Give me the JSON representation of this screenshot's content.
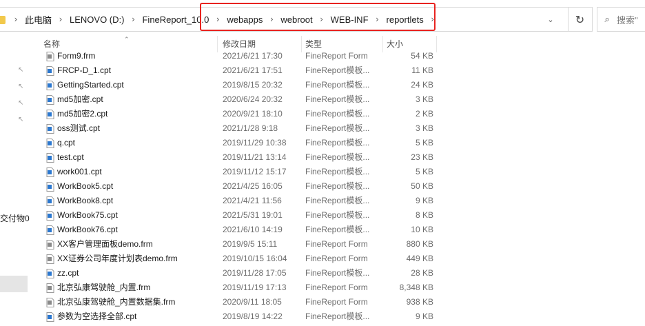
{
  "address": {
    "breadcrumbs": [
      "此电脑",
      "LENOVO (D:)",
      "FineReport_10.0",
      "webapps",
      "webroot",
      "WEB-INF",
      "reportlets"
    ],
    "dropdown_icon": "chevron-down-icon",
    "refresh_icon": "refresh-icon"
  },
  "search": {
    "placeholder": "搜索\""
  },
  "nav": {
    "partial_label": "交付物0"
  },
  "columns": {
    "name": "名称",
    "date": "修改日期",
    "type": "类型",
    "size": "大小"
  },
  "colors": {
    "highlight": "#e8231f",
    "cpt_icon": "#2b78d0",
    "frm_icon": "#8a8a8a"
  },
  "files": [
    {
      "name": "Form9.frm",
      "date": "2021/6/21 17:30",
      "type": "FineReport Form",
      "size": "54 KB",
      "kind": "frm"
    },
    {
      "name": "FRCP-D_1.cpt",
      "date": "2021/6/21 17:51",
      "type": "FineReport模板...",
      "size": "11 KB",
      "kind": "cpt"
    },
    {
      "name": "GettingStarted.cpt",
      "date": "2019/8/15 20:32",
      "type": "FineReport模板...",
      "size": "24 KB",
      "kind": "cpt"
    },
    {
      "name": "md5加密.cpt",
      "date": "2020/6/24 20:32",
      "type": "FineReport模板...",
      "size": "3 KB",
      "kind": "cpt"
    },
    {
      "name": "md5加密2.cpt",
      "date": "2020/9/21 18:10",
      "type": "FineReport模板...",
      "size": "2 KB",
      "kind": "cpt"
    },
    {
      "name": "oss测试.cpt",
      "date": "2021/1/28 9:18",
      "type": "FineReport模板...",
      "size": "3 KB",
      "kind": "cpt"
    },
    {
      "name": "q.cpt",
      "date": "2019/11/29 10:38",
      "type": "FineReport模板...",
      "size": "5 KB",
      "kind": "cpt"
    },
    {
      "name": "test.cpt",
      "date": "2019/11/21 13:14",
      "type": "FineReport模板...",
      "size": "23 KB",
      "kind": "cpt"
    },
    {
      "name": "work001.cpt",
      "date": "2019/11/12 15:17",
      "type": "FineReport模板...",
      "size": "5 KB",
      "kind": "cpt"
    },
    {
      "name": "WorkBook5.cpt",
      "date": "2021/4/25 16:05",
      "type": "FineReport模板...",
      "size": "50 KB",
      "kind": "cpt"
    },
    {
      "name": "WorkBook8.cpt",
      "date": "2021/4/21 11:56",
      "type": "FineReport模板...",
      "size": "9 KB",
      "kind": "cpt"
    },
    {
      "name": "WorkBook75.cpt",
      "date": "2021/5/31 19:01",
      "type": "FineReport模板...",
      "size": "8 KB",
      "kind": "cpt"
    },
    {
      "name": "WorkBook76.cpt",
      "date": "2021/6/10 14:19",
      "type": "FineReport模板...",
      "size": "10 KB",
      "kind": "cpt"
    },
    {
      "name": "XX客户管理面板demo.frm",
      "date": "2019/9/5 15:11",
      "type": "FineReport Form",
      "size": "880 KB",
      "kind": "frm"
    },
    {
      "name": "XX证券公司年度计划表demo.frm",
      "date": "2019/10/15 16:04",
      "type": "FineReport Form",
      "size": "449 KB",
      "kind": "frm"
    },
    {
      "name": "zz.cpt",
      "date": "2019/11/28 17:05",
      "type": "FineReport模板...",
      "size": "28 KB",
      "kind": "cpt"
    },
    {
      "name": "北京弘康驾驶舱_内置.frm",
      "date": "2019/11/19 17:13",
      "type": "FineReport Form",
      "size": "8,348 KB",
      "kind": "frm"
    },
    {
      "name": "北京弘康驾驶舱_内置数据集.frm",
      "date": "2020/9/11 18:05",
      "type": "FineReport Form",
      "size": "938 KB",
      "kind": "frm"
    },
    {
      "name": "参数为空选择全部.cpt",
      "date": "2019/8/19 14:22",
      "type": "FineReport模板...",
      "size": "9 KB",
      "kind": "cpt"
    }
  ]
}
